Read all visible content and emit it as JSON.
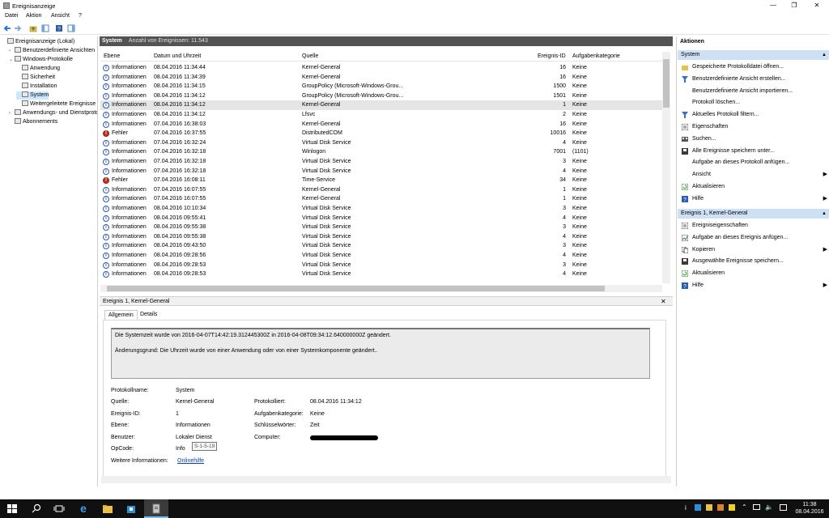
{
  "window": {
    "title": "Ereignisanzeige",
    "min": "—",
    "max": "❐",
    "close": "✕"
  },
  "menu": [
    "Datei",
    "Aktion",
    "Ansicht",
    "?"
  ],
  "tree": [
    {
      "label": "Ereignisanzeige (Lokal)",
      "indent": 0,
      "arrow": ""
    },
    {
      "label": "Benutzerdefinierte Ansichten",
      "indent": 1,
      "arrow": "›"
    },
    {
      "label": "Windows-Protokolle",
      "indent": 1,
      "arrow": "⌄"
    },
    {
      "label": "Anwendung",
      "indent": 2,
      "arrow": ""
    },
    {
      "label": "Sicherheit",
      "indent": 2,
      "arrow": ""
    },
    {
      "label": "Installation",
      "indent": 2,
      "arrow": ""
    },
    {
      "label": "System",
      "indent": 2,
      "arrow": "",
      "selected": true
    },
    {
      "label": "Weitergeleitete Ereignisse",
      "indent": 2,
      "arrow": ""
    },
    {
      "label": "Anwendungs- und Dienstprotokolle",
      "indent": 1,
      "arrow": "›"
    },
    {
      "label": "Abonnements",
      "indent": 1,
      "arrow": ""
    }
  ],
  "list": {
    "title": "System",
    "count_label": "Anzahl von Ereignissen: 11.543",
    "columns": [
      "Ebene",
      "Datum und Uhrzeit",
      "Quelle",
      "Ereignis-ID",
      "Aufgabenkategorie"
    ],
    "rows": [
      {
        "lvl": "Informationen",
        "err": false,
        "date": "08.04.2016 11:34:44",
        "src": "Kernel-General",
        "id": "16",
        "cat": "Keine"
      },
      {
        "lvl": "Informationen",
        "err": false,
        "date": "08.04.2016 11:34:39",
        "src": "Kernel-General",
        "id": "16",
        "cat": "Keine"
      },
      {
        "lvl": "Informationen",
        "err": false,
        "date": "08.04.2016 11:34:15",
        "src": "GroupPolicy (Microsoft-Windows-Grou...",
        "id": "1500",
        "cat": "Keine"
      },
      {
        "lvl": "Informationen",
        "err": false,
        "date": "08.04.2016 11:34:12",
        "src": "GroupPolicy (Microsoft-Windows-Grou...",
        "id": "1501",
        "cat": "Keine"
      },
      {
        "lvl": "Informationen",
        "err": false,
        "date": "08.04.2016 11:34:12",
        "src": "Kernel-General",
        "id": "1",
        "cat": "Keine",
        "selected": true
      },
      {
        "lvl": "Informationen",
        "err": false,
        "date": "08.04.2016 11:34:12",
        "src": "Lfsvc",
        "id": "2",
        "cat": "Keine"
      },
      {
        "lvl": "Informationen",
        "err": false,
        "date": "07.04.2016 16:38:03",
        "src": "Kernel-General",
        "id": "16",
        "cat": "Keine"
      },
      {
        "lvl": "Fehler",
        "err": true,
        "date": "07.04.2016 16:37:55",
        "src": "DistributedCOM",
        "id": "10016",
        "cat": "Keine"
      },
      {
        "lvl": "Informationen",
        "err": false,
        "date": "07.04.2016 16:32:24",
        "src": "Virtual Disk Service",
        "id": "4",
        "cat": "Keine"
      },
      {
        "lvl": "Informationen",
        "err": false,
        "date": "07.04.2016 16:32:18",
        "src": "Winlogon",
        "id": "7001",
        "cat": "(1101)"
      },
      {
        "lvl": "Informationen",
        "err": false,
        "date": "07.04.2016 16:32:18",
        "src": "Virtual Disk Service",
        "id": "3",
        "cat": "Keine"
      },
      {
        "lvl": "Informationen",
        "err": false,
        "date": "07.04.2016 16:32:18",
        "src": "Virtual Disk Service",
        "id": "4",
        "cat": "Keine"
      },
      {
        "lvl": "Fehler",
        "err": true,
        "date": "07.04.2016 16:08:11",
        "src": "Time-Service",
        "id": "34",
        "cat": "Keine"
      },
      {
        "lvl": "Informationen",
        "err": false,
        "date": "07.04.2016 16:07:55",
        "src": "Kernel-General",
        "id": "1",
        "cat": "Keine"
      },
      {
        "lvl": "Informationen",
        "err": false,
        "date": "07.04.2016 16:07:55",
        "src": "Kernel-General",
        "id": "1",
        "cat": "Keine"
      },
      {
        "lvl": "Informationen",
        "err": false,
        "date": "08.04.2016 10:10:34",
        "src": "Virtual Disk Service",
        "id": "3",
        "cat": "Keine"
      },
      {
        "lvl": "Informationen",
        "err": false,
        "date": "08.04.2016 09:55:41",
        "src": "Virtual Disk Service",
        "id": "4",
        "cat": "Keine"
      },
      {
        "lvl": "Informationen",
        "err": false,
        "date": "08.04.2016 09:55:38",
        "src": "Virtual Disk Service",
        "id": "3",
        "cat": "Keine"
      },
      {
        "lvl": "Informationen",
        "err": false,
        "date": "08.04.2016 09:55:38",
        "src": "Virtual Disk Service",
        "id": "4",
        "cat": "Keine"
      },
      {
        "lvl": "Informationen",
        "err": false,
        "date": "08.04.2016 09:43:50",
        "src": "Virtual Disk Service",
        "id": "3",
        "cat": "Keine"
      },
      {
        "lvl": "Informationen",
        "err": false,
        "date": "08.04.2016 09:28:56",
        "src": "Virtual Disk Service",
        "id": "4",
        "cat": "Keine"
      },
      {
        "lvl": "Informationen",
        "err": false,
        "date": "08.04.2016 09:28:53",
        "src": "Virtual Disk Service",
        "id": "3",
        "cat": "Keine"
      },
      {
        "lvl": "Informationen",
        "err": false,
        "date": "08.04.2016 09:28:53",
        "src": "Virtual Disk Service",
        "id": "4",
        "cat": "Keine"
      }
    ]
  },
  "detail": {
    "title": "Ereignis 1, Kernel-General",
    "close": "✕",
    "tabs": [
      "Allgemein",
      "Details"
    ],
    "message1": "Die Systemzeit wurde von 2016-04-07T14:42:19.312445300Z in 2016-04-08T09:34:12.640000000Z geändert.",
    "message2": "Änderungsgrund: Die Uhrzeit wurde von einer Anwendung oder von einer Systemkomponente geändert..",
    "fields": {
      "protokollname_label": "Protokollname:",
      "protokollname": "System",
      "quelle_label": "Quelle:",
      "quelle": "Kernel-General",
      "protokolliert_label": "Protokolliert:",
      "protokolliert": "08.04.2016 11:34:12",
      "ereignisid_label": "Ereignis-ID:",
      "ereignisid": "1",
      "aufgabe_label": "Aufgabenkategorie:",
      "aufgabe": "Keine",
      "ebene_label": "Ebene:",
      "ebene": "Informationen",
      "schluessel_label": "Schlüsselwörter:",
      "schluessel": "Zeit",
      "benutzer_label": "Benutzer:",
      "benutzer": "Lokaler Dienst",
      "computer_label": "Computer:",
      "opcode_label": "OpCode:",
      "opcode": "Info",
      "weitere_label": "Weitere Informationen:",
      "weitere": "Onlinehilfe",
      "tooltip": "S-1-5-19"
    }
  },
  "actions": {
    "title": "Aktionen",
    "section1": "System",
    "items1": [
      {
        "label": "Gespeicherte Protokolldatei öffnen...",
        "icon": "folder-open-icon",
        "submenu": false
      },
      {
        "label": "Benutzerdefinierte Ansicht erstellen...",
        "icon": "filter-icon",
        "submenu": false
      },
      {
        "label": "Benutzerdefinierte Ansicht importieren...",
        "icon": "",
        "submenu": false
      },
      {
        "label": "Protokoll löschen...",
        "icon": "",
        "submenu": false
      },
      {
        "label": "Aktuelles Protokoll filtern...",
        "icon": "filter-icon",
        "submenu": false
      },
      {
        "label": "Eigenschaften",
        "icon": "properties-icon",
        "submenu": false
      },
      {
        "label": "Suchen...",
        "icon": "find-icon",
        "submenu": false
      },
      {
        "label": "Alle Ereignisse speichern unter...",
        "icon": "save-icon",
        "submenu": false
      },
      {
        "label": "Aufgabe an dieses Protokoll anfügen...",
        "icon": "",
        "submenu": false
      },
      {
        "label": "Ansicht",
        "icon": "",
        "submenu": true
      },
      {
        "label": "Aktualisieren",
        "icon": "refresh-icon",
        "submenu": false
      },
      {
        "label": "Hilfe",
        "icon": "help-icon",
        "submenu": true
      }
    ],
    "section2": "Ereignis 1, Kernel-General",
    "items2": [
      {
        "label": "Ereigniseigenschaften",
        "icon": "event-properties-icon",
        "submenu": false
      },
      {
        "label": "Aufgabe an dieses Ereignis anfügen...",
        "icon": "task-icon",
        "submenu": false
      },
      {
        "label": "Kopieren",
        "icon": "copy-icon",
        "submenu": true
      },
      {
        "label": "Ausgewählte Ereignisse speichern...",
        "icon": "save-icon",
        "submenu": false
      },
      {
        "label": "Aktualisieren",
        "icon": "refresh-icon",
        "submenu": false
      },
      {
        "label": "Hilfe",
        "icon": "help-icon",
        "submenu": true
      }
    ]
  },
  "taskbar": {
    "time": "11:38",
    "date": "08.04.2016"
  },
  "colors": {
    "accent": "#cde0f4",
    "selection": "#cce8ff",
    "header": "#535353",
    "error": "#c42b1c",
    "info": "#2b5aa9",
    "taskbar": "#101010"
  }
}
